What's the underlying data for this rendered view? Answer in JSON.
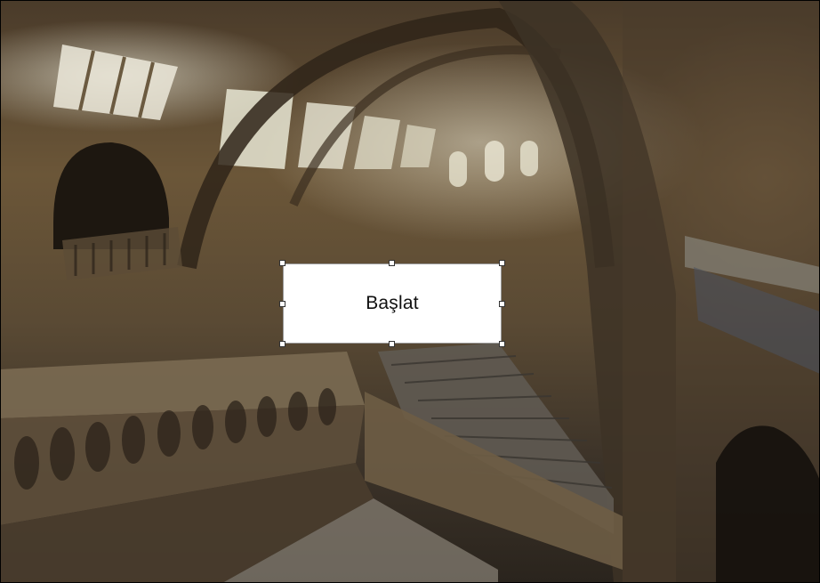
{
  "background_image": {
    "icon": "architecture-photo"
  },
  "textbox": {
    "label": "Başlat"
  },
  "colors": {
    "textbox_fill": "#ffffff",
    "handle_border": "#333333",
    "photo_base": "#5a4a34"
  }
}
